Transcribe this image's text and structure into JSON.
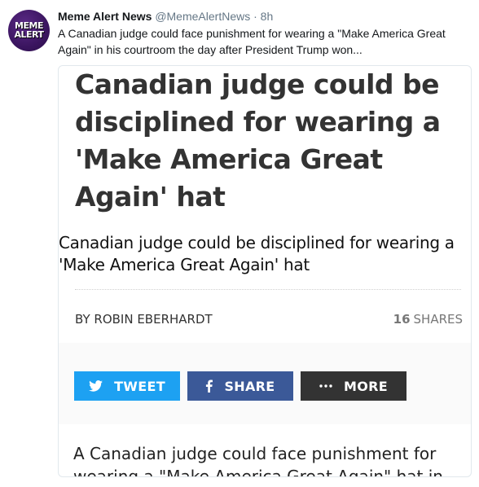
{
  "account": {
    "name": "Meme Alert News",
    "handle": "@MemeAlertNews",
    "separator": "·",
    "time": "8h",
    "avatar_text_1": "MEME",
    "avatar_text_2": "ALERT"
  },
  "tweet": {
    "text": "A Canadian judge could face punishment for wearing a \"Make America Great Again\" in his courtroom the day after President Trump won..."
  },
  "card": {
    "headline": "Canadian judge could be disciplined for wearing a 'Make America Great Again' hat",
    "subheadline": "Canadian judge could be disciplined for wearing a 'Make America Great Again' hat",
    "byline": "BY ROBIN EBERHARDT",
    "shares_count": "16",
    "shares_label": "SHARES",
    "buttons": {
      "tweet": "TWEET",
      "share": "SHARE",
      "more": "MORE"
    },
    "body_text": "A Canadian judge could face punishment for wearing a \"Make America Great Again\" hat in his"
  },
  "colors": {
    "tweet_button": "#1da1f2",
    "share_button": "#3b5998",
    "more_button": "#333333",
    "avatar_bg": "#3b1560"
  },
  "icons": [
    "twitter-bird-icon",
    "facebook-f-icon",
    "more-dots-icon"
  ]
}
